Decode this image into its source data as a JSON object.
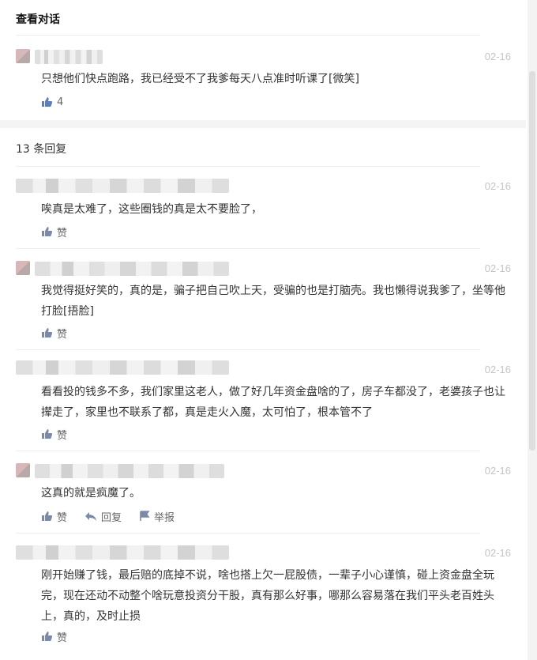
{
  "header": {
    "title": "查看对话"
  },
  "top_comment": {
    "date": "02-16",
    "text": "只想他们快点跑路，我已经受不了我爹每天八点准时听课了[微笑]",
    "like_count": "4"
  },
  "replies_header": {
    "label": "13 条回复"
  },
  "replies": [
    {
      "date": "02-16",
      "text": "唉真是太难了，这些圈钱的真是太不要脸了，",
      "like_label": "赞"
    },
    {
      "date": "02-16",
      "text": "我觉得挺好笑的，真的是，骗子把自己吹上天，受骗的也是打脑壳。我也懒得说我爹了，坐等他打脸[捂脸]",
      "like_label": "赞"
    },
    {
      "date": "02-16",
      "text": "看看投的钱多不多，我们家里这老人，做了好几年资金盘啥的了，房子车都没了，老婆孩子也让撵走了，家里也不联系了都，真是走火入魔，太可怕了，根本管不了",
      "like_label": "赞"
    },
    {
      "date": "02-16",
      "text": "这真的就是疯魔了。",
      "like_label": "赞",
      "reply_label": "回复",
      "report_label": "举报"
    },
    {
      "date": "02-16",
      "text": "刚开始赚了钱，最后赔的底掉不说，啥也搭上欠一屁股债，一辈子小心谨慎，碰上资金盘全玩完，现在还动不动整个啥玩意投资分干股，真有那么好事，哪那么容易落在我们平头老百姓头上，真的，及时止损",
      "like_label": "赞"
    }
  ],
  "icons": {
    "like": "thumbs-up-icon",
    "reply": "reply-arrow-icon",
    "report": "flag-icon"
  },
  "colors": {
    "date": "#c4c4c4",
    "text": "#333333",
    "action": "#666666",
    "band": "#f4f4f4"
  }
}
